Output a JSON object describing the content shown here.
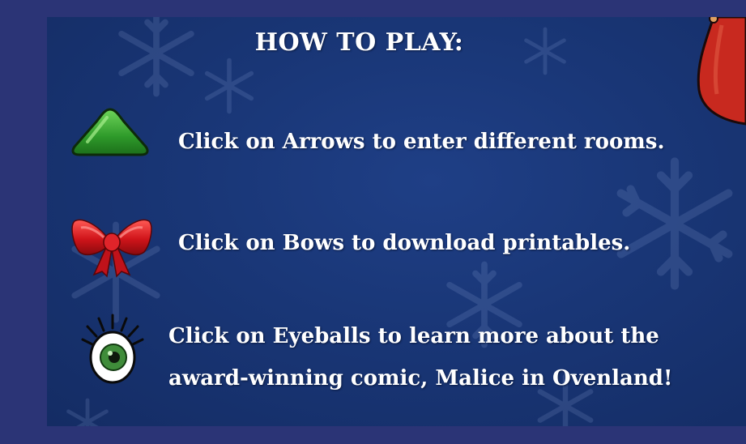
{
  "panel": {
    "title": "HOW TO PLAY:"
  },
  "instructions": [
    {
      "icon": "green-arrow-icon",
      "text": "Click on Arrows to enter different rooms."
    },
    {
      "icon": "red-bow-icon",
      "text": "Click on Bows to download printables."
    },
    {
      "icon": "eyeball-icon",
      "lines": [
        "Click on Eyeballs to learn more about the",
        "award-winning comic, Malice in Ovenland!"
      ]
    }
  ],
  "colors": {
    "background": "#2b3476",
    "panel": "#193676",
    "arrow": "#2e9a2a",
    "bow": "#d0141a",
    "eye_iris": "#3f8c3a",
    "text": "#ffffff"
  }
}
